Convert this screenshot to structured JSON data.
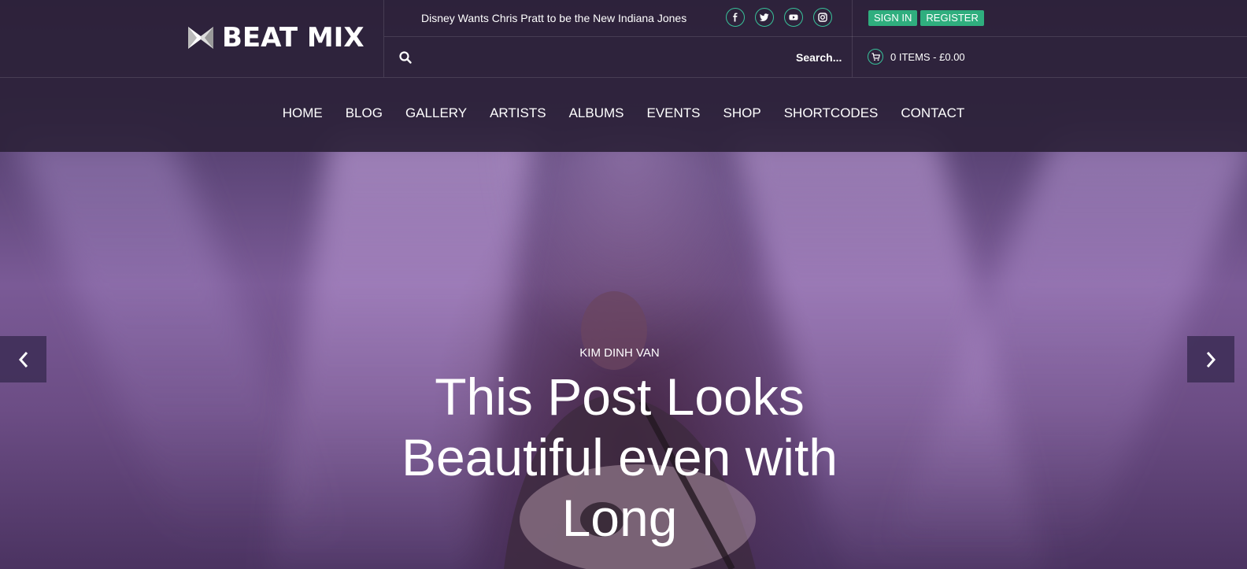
{
  "brand": {
    "name": "BEAT MIX",
    "logo_icon": "bowtie-logo-icon"
  },
  "topbar": {
    "ticker": "Disney Wants Chris Pratt to be the New Indiana Jones",
    "socials": [
      {
        "name": "facebook-icon",
        "glyph": "f"
      },
      {
        "name": "twitter-icon",
        "glyph": "t"
      },
      {
        "name": "youtube-icon",
        "glyph": "yt"
      },
      {
        "name": "instagram-icon",
        "glyph": "ig"
      }
    ],
    "sign_in": "SIGN IN",
    "register": "REGISTER"
  },
  "search": {
    "label": "Search..."
  },
  "cart": {
    "summary": "0 ITEMS - £0.00"
  },
  "nav": {
    "items": [
      "HOME",
      "BLOG",
      "GALLERY",
      "ARTISTS",
      "ALBUMS",
      "EVENTS",
      "SHOP",
      "SHORTCODES",
      "CONTACT"
    ]
  },
  "slide": {
    "author": "KIM DINH VAN",
    "title": "This Post Looks Beautiful even with Long"
  },
  "colors": {
    "accent": "#2fae7e",
    "header_bg": "#2c223a",
    "hero_tint": "#7a5a96"
  }
}
